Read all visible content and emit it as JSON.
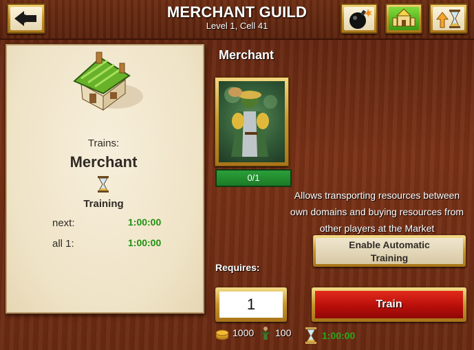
{
  "header": {
    "title": "MERCHANT GUILD",
    "subtitle": "Level 1, Cell 41",
    "back_icon": "back-arrow-icon",
    "bomb_icon": "bomb-icon",
    "building_icon": "building-upgrade-icon",
    "speedup_icon": "hourglass-upgrade-icon"
  },
  "left_panel": {
    "trains_label": "Trains:",
    "unit_name": "Merchant",
    "training_label": "Training",
    "next_label": "next:",
    "next_time": "1:00:00",
    "all_label": "all 1:",
    "all_time": "1:00:00"
  },
  "right_panel": {
    "unit_title": "Merchant",
    "count": "0/1",
    "description_line1": "Allows transporting resources between",
    "description_line2": "own domains and buying resources from",
    "description_line3": "other players at the Market",
    "auto_training_line1": "Enable Automatic",
    "auto_training_line2": "Training",
    "requires_label": "Requires:",
    "quantity": "1",
    "train_label": "Train",
    "gold_cost": "1000",
    "population_cost": "100",
    "total_time": "1:00:00"
  },
  "colors": {
    "wood_bg": "#6a2a12",
    "parchment": "#efe3c6",
    "gold_frame": "#c8952a",
    "train_red": "#c0140d",
    "time_green": "#1e8f12"
  }
}
